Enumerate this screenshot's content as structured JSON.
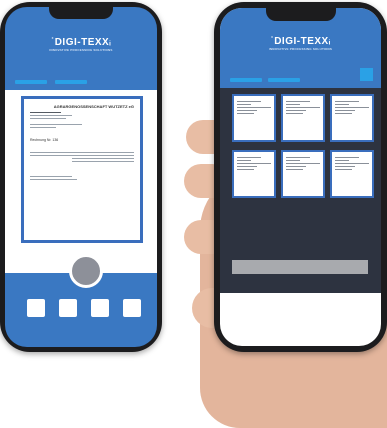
{
  "brand": {
    "logo_text": "˙DIGI-TEXXᵢ",
    "logo_sub": "INNOVATIVE PROCESSING SOLUTIONS",
    "primary_color": "#3a78c2",
    "accent_color": "#2aa1e6",
    "dark_color": "#2d3340"
  },
  "document": {
    "company": "AGRARGENOSSENSCHAFT WUTZETZ eG",
    "invoice_label": "Rechnung Nr. 136"
  },
  "thumbnails_count_label": ""
}
